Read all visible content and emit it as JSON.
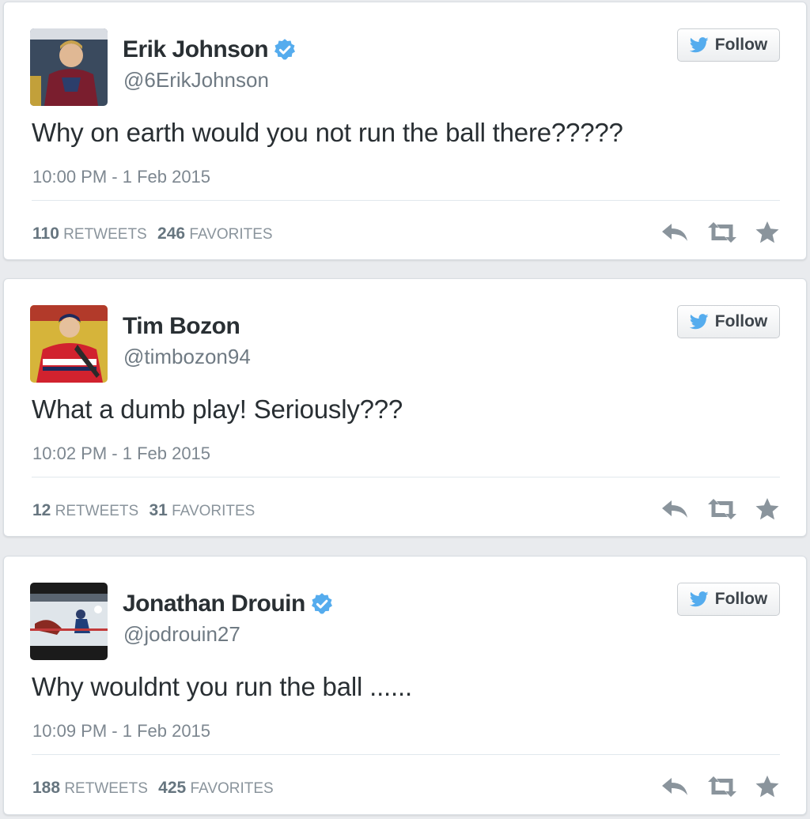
{
  "tweets": [
    {
      "name": "Erik Johnson",
      "verified": true,
      "handle": "@6ErikJohnson",
      "avatar_icon": "hockey-player-avatar-1",
      "follow_label": "Follow",
      "text": "Why on earth would you not run the ball there?????",
      "timestamp": "10:00 PM - 1 Feb 2015",
      "retweets": "110",
      "retweets_label": "RETWEETS",
      "favorites": "246",
      "favorites_label": "FAVORITES"
    },
    {
      "name": "Tim Bozon",
      "verified": false,
      "handle": "@timbozon94",
      "avatar_icon": "hockey-player-avatar-2",
      "follow_label": "Follow",
      "text": "What a dumb play! Seriously???",
      "timestamp": "10:02 PM - 1 Feb 2015",
      "retweets": "12",
      "retweets_label": "RETWEETS",
      "favorites": "31",
      "favorites_label": "FAVORITES"
    },
    {
      "name": "Jonathan Drouin",
      "verified": true,
      "handle": "@jodrouin27",
      "avatar_icon": "hockey-game-avatar-3",
      "follow_label": "Follow",
      "text": "Why wouldnt you run the ball ......",
      "timestamp": "10:09 PM - 1 Feb 2015",
      "retweets": "188",
      "retweets_label": "RETWEETS",
      "favorites": "425",
      "favorites_label": "FAVORITES"
    }
  ],
  "colors": {
    "twitter_blue": "#55acee",
    "verified_blue": "#55acee",
    "action_gray": "#8a949c"
  },
  "icons": [
    "bird-icon",
    "verified-badge-icon",
    "reply-icon",
    "retweet-icon",
    "favorite-star-icon"
  ]
}
